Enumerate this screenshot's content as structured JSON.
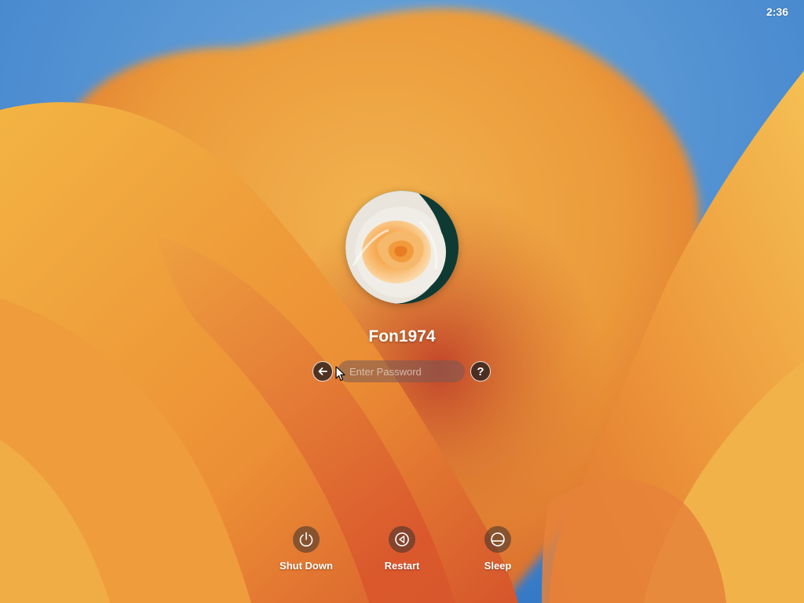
{
  "status_bar": {
    "time": "2:36"
  },
  "login": {
    "username": "Fon1974",
    "avatar_icon": "rose-photo",
    "back_icon": "arrow-left-circle-icon",
    "password_placeholder": "Enter Password",
    "password_value": "",
    "help_icon": "question-mark-icon",
    "help_symbol": "?"
  },
  "power_options": [
    {
      "label": "Shut Down",
      "icon": "power-icon"
    },
    {
      "label": "Restart",
      "icon": "restart-icon"
    },
    {
      "label": "Sleep",
      "icon": "sleep-icon"
    }
  ],
  "colors": {
    "sky_blue": "#3f86cf",
    "petal_orange": "#e8913a",
    "petal_red": "#c2452a",
    "petal_yellow": "#f0bd50"
  }
}
